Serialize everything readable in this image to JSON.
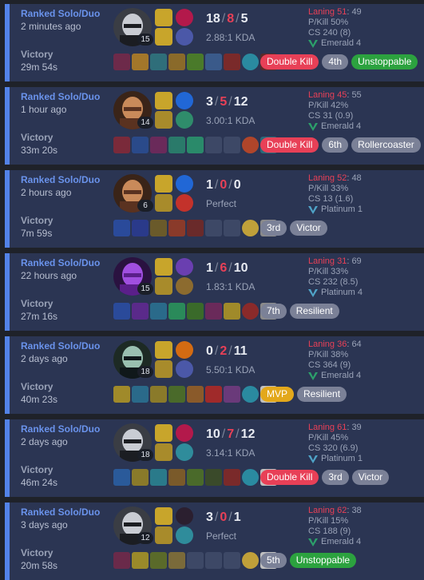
{
  "colors": {
    "accent": "#5383e8",
    "card_bg": "#2b3553",
    "deaths": "#e84057",
    "page_bg": "#1f2229"
  },
  "matches": [
    {
      "queue": "Ranked Solo/Duo",
      "time_ago": "2 minutes ago",
      "result": "Victory",
      "duration": "29m 54s",
      "champion_icon": "armored-knight-champion-icon",
      "champion_level": "15",
      "kills": "18",
      "deaths": "8",
      "assists": "5",
      "ratio": "2.88:1 KDA",
      "laning_label": "Laning 51",
      "laning_value": ": 49",
      "pkill": "P/Kill 50%",
      "cs": "CS 240 (8)",
      "rank": "Emerald 4",
      "tags": [
        {
          "label": "Double Kill",
          "color": "red"
        },
        {
          "label": "4th",
          "color": "gray"
        },
        {
          "label": "Unstoppable",
          "color": "green"
        }
      ]
    },
    {
      "queue": "Ranked Solo/Duo",
      "time_ago": "1 hour ago",
      "result": "Victory",
      "duration": "33m 20s",
      "champion_icon": "warrior-woman-champion-icon",
      "champion_level": "14",
      "kills": "3",
      "deaths": "5",
      "assists": "12",
      "ratio": "3.00:1 KDA",
      "laning_label": "Laning 45",
      "laning_value": ": 55",
      "pkill": "P/Kill 42%",
      "cs": "CS 31 (0.9)",
      "rank": "Emerald 4",
      "tags": [
        {
          "label": "Double Kill",
          "color": "red"
        },
        {
          "label": "6th",
          "color": "gray"
        },
        {
          "label": "Rollercoaster",
          "color": "gray"
        }
      ]
    },
    {
      "queue": "Ranked Solo/Duo",
      "time_ago": "2 hours ago",
      "result": "Victory",
      "duration": "7m 59s",
      "champion_icon": "warrior-woman-champion-icon",
      "champion_level": "6",
      "kills": "1",
      "deaths": "0",
      "assists": "0",
      "ratio": "Perfect",
      "laning_label": "Laning 52",
      "laning_value": ": 48",
      "pkill": "P/Kill 33%",
      "cs": "CS 13 (1.6)",
      "rank": "Platinum 1",
      "tags": [
        {
          "label": "3rd",
          "color": "gray"
        },
        {
          "label": "Victor",
          "color": "gray"
        }
      ]
    },
    {
      "queue": "Ranked Solo/Duo",
      "time_ago": "22 hours ago",
      "result": "Victory",
      "duration": "27m 16s",
      "champion_icon": "void-creature-champion-icon",
      "champion_level": "15",
      "kills": "1",
      "deaths": "6",
      "assists": "10",
      "ratio": "1.83:1 KDA",
      "laning_label": "Laning 31",
      "laning_value": ": 69",
      "pkill": "P/Kill 33%",
      "cs": "CS 232 (8.5)",
      "rank": "Platinum 4",
      "tags": [
        {
          "label": "7th",
          "color": "gray"
        },
        {
          "label": "Resilient",
          "color": "gray"
        }
      ]
    },
    {
      "queue": "Ranked Solo/Duo",
      "time_ago": "2 days ago",
      "result": "Victory",
      "duration": "40m 23s",
      "champion_icon": "hooded-assassin-champion-icon",
      "champion_level": "18",
      "kills": "0",
      "deaths": "2",
      "assists": "11",
      "ratio": "5.50:1 KDA",
      "laning_label": "Laning 36",
      "laning_value": ": 64",
      "pkill": "P/Kill 38%",
      "cs": "CS 364 (9)",
      "rank": "Emerald 4",
      "tags": [
        {
          "label": "MVP",
          "color": "gold"
        },
        {
          "label": "Resilient",
          "color": "gray"
        }
      ]
    },
    {
      "queue": "Ranked Solo/Duo",
      "time_ago": "2 days ago",
      "result": "Victory",
      "duration": "46m 24s",
      "champion_icon": "armored-knight-champion-icon",
      "champion_level": "18",
      "kills": "10",
      "deaths": "7",
      "assists": "12",
      "ratio": "3.14:1 KDA",
      "laning_label": "Laning 61",
      "laning_value": ": 39",
      "pkill": "P/Kill 45%",
      "cs": "CS 320 (6.9)",
      "rank": "Platinum 1",
      "tags": [
        {
          "label": "Double Kill",
          "color": "red"
        },
        {
          "label": "3rd",
          "color": "gray"
        },
        {
          "label": "Victor",
          "color": "gray"
        }
      ]
    },
    {
      "queue": "Ranked Solo/Duo",
      "time_ago": "3 days ago",
      "result": "Victory",
      "duration": "20m 58s",
      "champion_icon": "armored-knight-champion-icon",
      "champion_level": "12",
      "kills": "3",
      "deaths": "0",
      "assists": "1",
      "ratio": "Perfect",
      "laning_label": "Laning 62",
      "laning_value": ": 38",
      "pkill": "P/Kill 15%",
      "cs": "CS 188 (9)",
      "rank": "Emerald 4",
      "tags": [
        {
          "label": "5th",
          "color": "gray"
        },
        {
          "label": "Unstoppable",
          "color": "green"
        }
      ]
    }
  ]
}
